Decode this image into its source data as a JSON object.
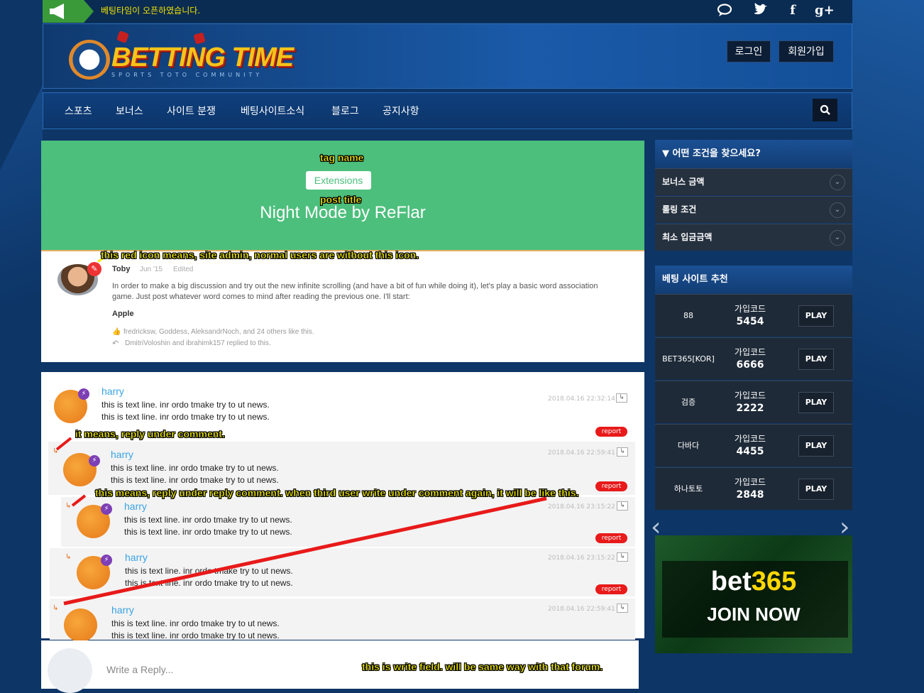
{
  "topbar": {
    "notice": "베팅타임이 오픈하였습니다.",
    "social": [
      {
        "icon": "chat-icon",
        "glyph": "💬"
      },
      {
        "icon": "twitter-icon",
        "glyph": "🐦"
      },
      {
        "icon": "facebook-icon",
        "glyph": "f"
      },
      {
        "icon": "google-plus-icon",
        "glyph": "g+"
      }
    ]
  },
  "header": {
    "logo_text": "BETTING TIME",
    "logo_sub": "SPORTS TOTO COMMUNITY",
    "login_label": "로그인",
    "signup_label": "회원가입"
  },
  "nav": {
    "items": [
      "스포츠",
      "보너스",
      "사이트 분쟁",
      "베팅사이트소식",
      "블로그",
      "공지사항"
    ],
    "search_icon": "search-icon"
  },
  "post": {
    "tag": "Extensions",
    "title": "Night Mode by ReFlar",
    "author": "Toby",
    "date": "Jun '15",
    "edited": "Edited",
    "body": "In order to make a big discussion and try out the new infinite scrolling (and have a bit of fun while doing it), let's play a basic word association game. Just post whatever word comes to mind after reading the previous one. I'll start:",
    "word": "Apple",
    "likes": "fredricksw, Goddess, AleksandrNoch, and 24 others like this.",
    "replies": "DmitriVoloshin and ibrahimk157 replied to this."
  },
  "annotations": {
    "tag_name": "tag name",
    "post_title": "post title",
    "admin_icon": "this red icon means, site admin, normal users are without this icon.",
    "reply_comment": "it means, reply under comment.",
    "reply_reply": "this means, reply under reply comment. when third user write under comment again, it will be like this.",
    "write_field": "this is write field. will be same way with that forum."
  },
  "comments": [
    {
      "name": "harry",
      "line1": "this is text line. inr ordo tmake try to ut news.",
      "line2": "this is text line. inr ordo tmake try to ut news.",
      "date": "2018.04.16 22:32:14",
      "report": "report"
    },
    {
      "name": "harry",
      "line1": "this is text line. inr ordo tmake try to ut news.",
      "line2": "this is text line. inr ordo tmake try to ut news.",
      "date": "2018.04.16 22:59:41",
      "report": "report"
    },
    {
      "name": "harry",
      "line1": "this is text line. inr ordo tmake try to ut news.",
      "line2": "this is text line. inr ordo tmake try to ut news.",
      "date": "2018.04.16 23:15:22",
      "report": "report"
    },
    {
      "name": "harry",
      "line1": "this is text line. inr ordo tmake try to ut news.",
      "line2": "this is text line. inr ordo tmake try to ut news.",
      "date": "2018.04.16 23:15:22",
      "report": "report"
    },
    {
      "name": "harry",
      "line1": "this is text line. inr ordo tmake try to ut news.",
      "line2": "this is text line. inr ordo tmake try to ut news.",
      "date": "2018.04.16 22:59:41",
      "report": "report"
    }
  ],
  "write": {
    "placeholder": "Write a Reply..."
  },
  "sidebar": {
    "filter_title": "어떤 조건을 찾으세요?",
    "filters": [
      "보너스 금액",
      "롤링 조건",
      "최소 입금금액"
    ],
    "rec_title": "베팅 사이트 추천",
    "sites": [
      {
        "name": "88",
        "code_label": "가입코드",
        "code": "5454",
        "play": "PLAY"
      },
      {
        "name": "BET365[KOR]",
        "code_label": "가입코드",
        "code": "6666",
        "play": "PLAY"
      },
      {
        "name": "검증",
        "code_label": "가입코드",
        "code": "2222",
        "play": "PLAY"
      },
      {
        "name": "다바다",
        "code_label": "가입코드",
        "code": "4455",
        "play": "PLAY"
      },
      {
        "name": "하나토토",
        "code_label": "가입코드",
        "code": "2848",
        "play": "PLAY"
      }
    ],
    "banner_brand_a": "bet",
    "banner_brand_b": "365",
    "banner_cta": "JOIN NOW"
  }
}
